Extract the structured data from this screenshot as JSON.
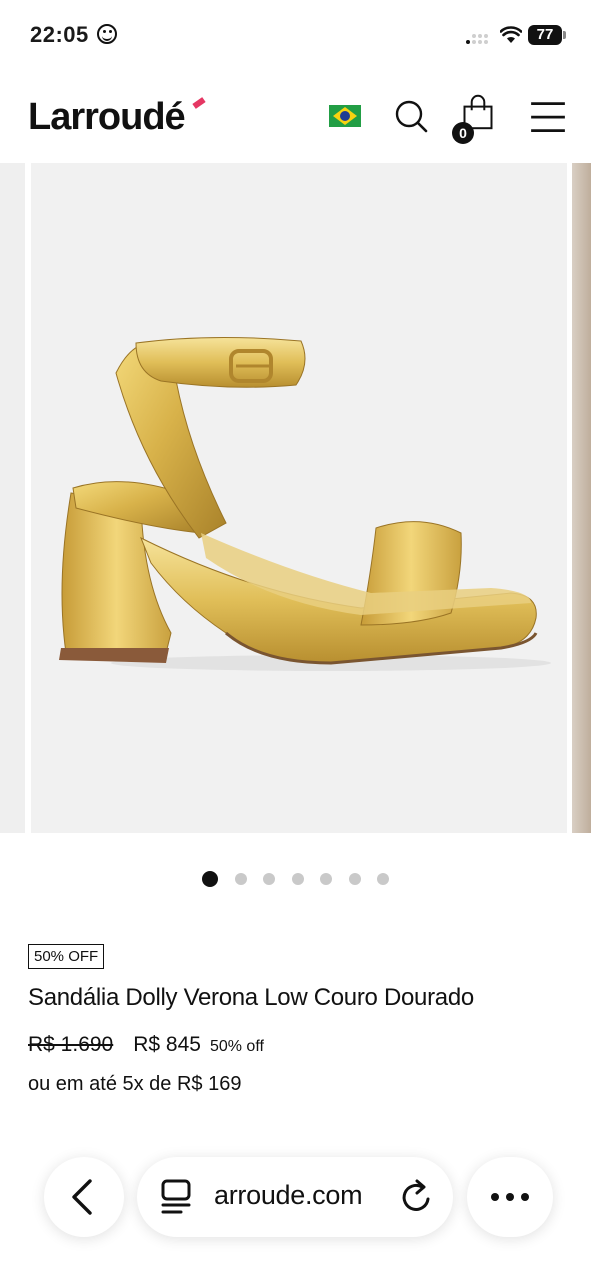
{
  "status_bar": {
    "time": "22:05",
    "battery": "77"
  },
  "header": {
    "logo": "Larroudé",
    "cart_count": "0",
    "icons": [
      "brazil-flag-icon",
      "search-icon",
      "cart-icon",
      "menu-icon"
    ]
  },
  "carousel": {
    "image_alt": "gold metallic platform sandal",
    "total_slides": 7,
    "active_slide": 1
  },
  "product": {
    "badge": "50% OFF",
    "title": "Sandália Dolly Verona Low Couro Dourado",
    "price_old": "R$ 1.690",
    "price_new": "R$ 845",
    "discount": "50% off",
    "installments": "ou em até 5x de R$ 169"
  },
  "browser": {
    "url": "arroude.com",
    "icons": [
      "back-icon",
      "tabs-icon",
      "reload-icon",
      "more-icon"
    ]
  },
  "colors": {
    "brand_accent": "#e53763",
    "text": "#111111",
    "image_bg": "#f1f1f1",
    "gold": "#d4b04a"
  }
}
